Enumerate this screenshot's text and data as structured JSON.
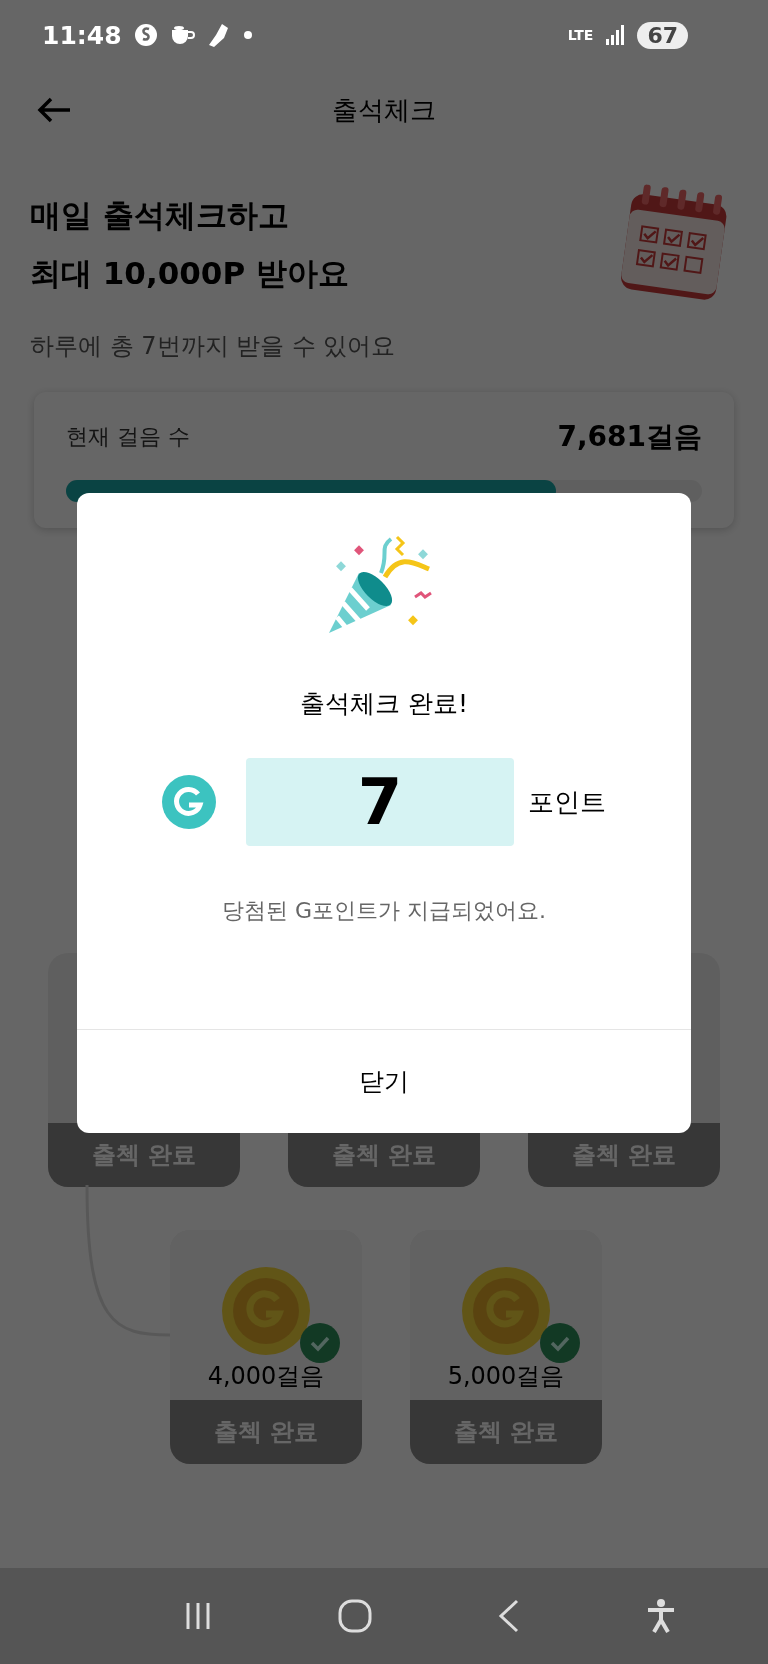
{
  "status_bar": {
    "time": "11:48",
    "network": "LTE",
    "battery": "67"
  },
  "header": {
    "title": "출석체크"
  },
  "hero": {
    "title_lines": [
      "매일 출석체크하고",
      "최대 10,000P 받아요"
    ],
    "subtitle": "하루에 총 7번까지 받을 수 있어요"
  },
  "steps_card": {
    "label": "현재 걸음 수",
    "value": "7,681걸음",
    "level": 0.77
  },
  "steps_row_1": [
    {
      "button": "출첵 완료"
    },
    {
      "button": "출첵 완료"
    },
    {
      "button": "출첵 완료"
    }
  ],
  "steps_row_2": [
    {
      "label": "4,000걸음",
      "checked": true,
      "button": "출첵 완료"
    },
    {
      "label": "5,000걸음",
      "checked": true,
      "button": "출첵 완료"
    }
  ],
  "dialog": {
    "title": "출석체크 완료!",
    "points": "7",
    "unit": "포인트",
    "message": "당첨된 G포인트가 지급되었어요.",
    "close": "닫기"
  }
}
